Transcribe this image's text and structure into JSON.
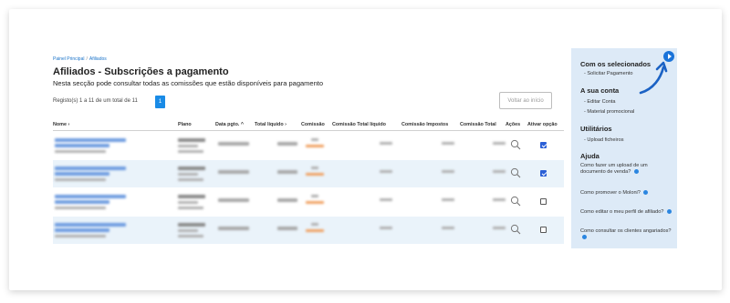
{
  "breadcrumb": {
    "home": "Painel Principal",
    "sep": "/",
    "current": "Afiliados"
  },
  "page": {
    "title": "Afiliados - Subscrições a pagamento",
    "subtitle": "Nesta secção pode consultar todas as comissões que estão disponíveis para pagamento",
    "records": "Registo(s) 1 a 11 de um total de 11",
    "page_number": "1",
    "back_button": "Voltar ao início"
  },
  "table": {
    "headers": [
      "Nome ›",
      "Plano",
      "Data pgto. ^",
      "Total líquido ›",
      "Comissão",
      "Comissão Total líquido",
      "Comissão Impostos",
      "Comissão Total",
      "Ações",
      "Ativar opção"
    ],
    "rows": [
      {
        "checked": true
      },
      {
        "checked": true
      },
      {
        "checked": false
      },
      {
        "checked": false
      }
    ]
  },
  "sidebar": {
    "section1_title": "Com os selecionados",
    "section1_items": [
      "- Solicitar Pagamento"
    ],
    "section2_title": "A sua conta",
    "section2_items": [
      "- Editar Conta",
      "- Material promocional"
    ],
    "section3_title": "Utilitários",
    "section3_items": [
      "- Upload ficheiros"
    ],
    "section4_title": "Ajuda",
    "help_items": [
      "Como fazer um upload de um documento de venda?",
      "Como promover o Moloni?",
      "Como editar o meu perfil de afiliado?",
      "Como consultar os clientes angariados?"
    ]
  },
  "colors": {
    "accent": "#1a8be6",
    "sidebar_bg": "#ddeaf7",
    "row_alt": "#eaf3fa"
  }
}
